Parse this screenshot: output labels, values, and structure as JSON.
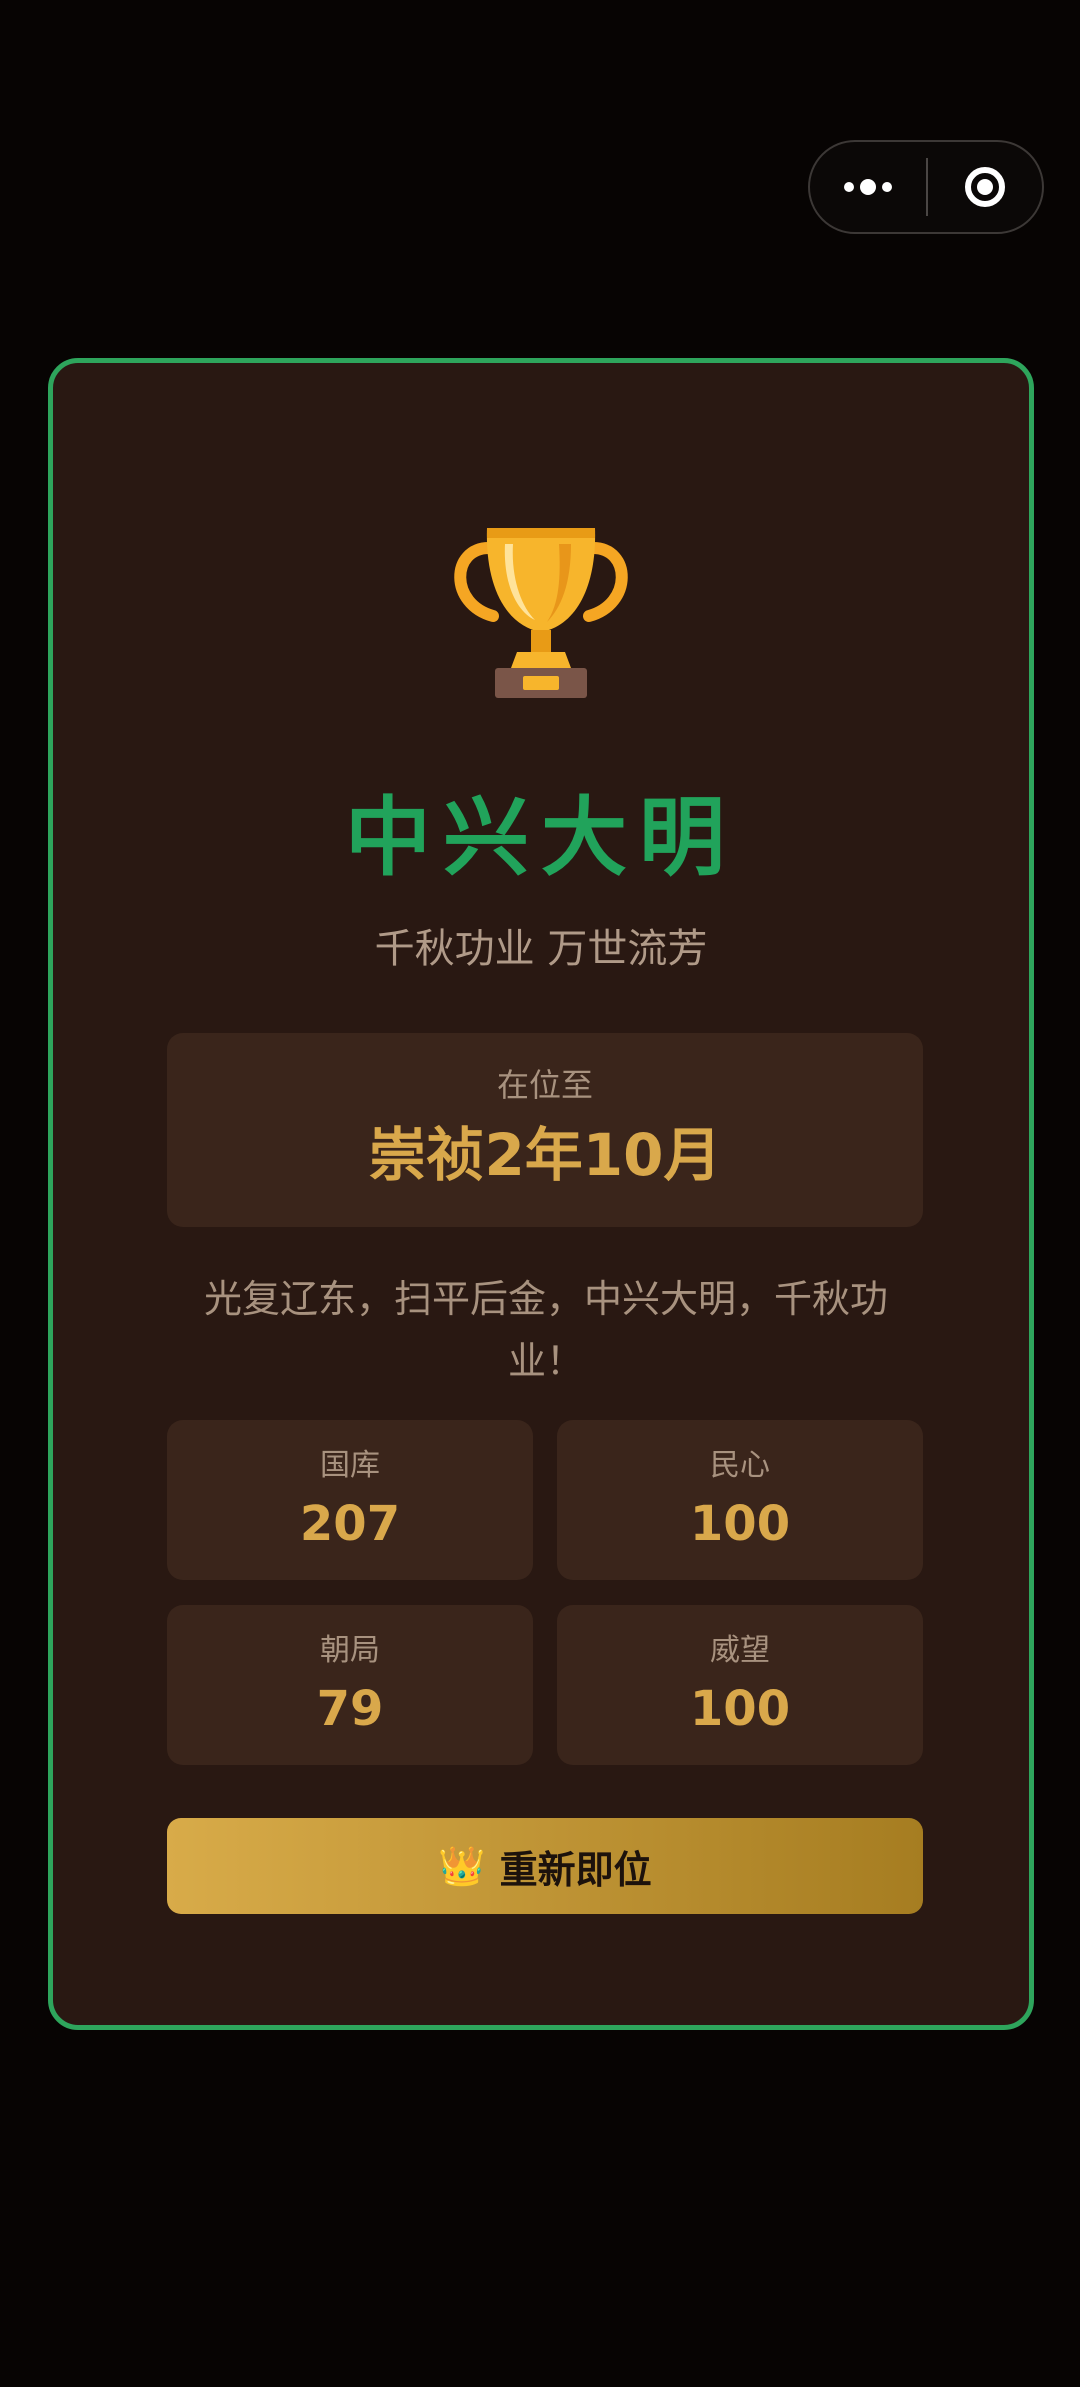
{
  "capsule": {
    "more_icon": "more-dots-icon",
    "close_icon": "target-close-icon"
  },
  "result": {
    "icon": "trophy-icon",
    "title": "中兴大明",
    "subtitle": "千秋功业 万世流芳",
    "reign_label": "在位至",
    "reign_value": "崇祯2年10月",
    "description": "光复辽东，扫平后金，中兴大明，千秋功业！"
  },
  "stats": [
    {
      "label": "国库",
      "value": "207"
    },
    {
      "label": "民心",
      "value": "100"
    },
    {
      "label": "朝局",
      "value": "79"
    },
    {
      "label": "威望",
      "value": "100"
    }
  ],
  "restart": {
    "icon": "crown-icon",
    "glyph": "👑",
    "label": "重新即位"
  },
  "colors": {
    "accent_green": "#21a35b",
    "gold": "#d9a84b",
    "card_bg": "#291812",
    "panel_bg": "#3a251b"
  }
}
